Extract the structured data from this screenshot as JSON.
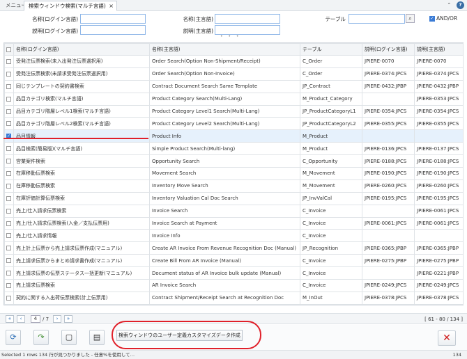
{
  "tabs": {
    "menu_label": "メニュー",
    "active_label": "検索ウィンドウ検索(マルチ言語)",
    "close_glyph": "×"
  },
  "top_icons": {
    "collapse": "⌃",
    "help": "?"
  },
  "filters": {
    "name_login": "名称(ログイン言語)",
    "desc_login": "説明(ログイン言語)",
    "name_main": "名称(主言語)",
    "desc_main": "説明(主言語)",
    "table": "テーブル",
    "andor": "AND/OR",
    "andor_checked": true
  },
  "grid": {
    "columns": [
      "名称(ログイン言語)",
      "名称(主言語)",
      "テーブル",
      "説明(ログイン言語)",
      "説明(主言語)"
    ],
    "rows": [
      {
        "name_login": "受発注伝票検索(未入出発注伝票選択用)",
        "name_main": "Order Search(Option Non-Shipment/Receipt)",
        "table": "C_Order",
        "desc_login": "JPIERE-0070",
        "desc_main": "JPIERE-0070",
        "checked": false
      },
      {
        "name_login": "受発注伝票検索(未請求受発注伝票選択用)",
        "name_main": "Order Search(Option Non-Invoice)",
        "table": "C_Order",
        "desc_login": "JPIERE-0374:JPCS",
        "desc_main": "JPIERE-0374:JPCS",
        "checked": false
      },
      {
        "name_login": "同じテンプレートの契約書検索",
        "name_main": "Contract Document Search Same Template",
        "table": "JP_Contract",
        "desc_login": "JPIERE-0432:JPBP",
        "desc_main": "JPIERE-0432:JPBP",
        "checked": false
      },
      {
        "name_login": "品目カテゴリ検索(マルチ言語)",
        "name_main": "Product Category Search(Multi-Lang)",
        "table": "M_Product_Category",
        "desc_login": "",
        "desc_main": "JPIERE-0353:JPCS",
        "checked": false
      },
      {
        "name_login": "品目カテゴリ階層レベル1検索(マルチ言語)",
        "name_main": "Product Category Level1 Search(Multi-Lang)",
        "table": "JP_ProductCategoryL1",
        "desc_login": "JPIERE-0354:JPCS",
        "desc_main": "JPIERE-0354:JPCS",
        "checked": false
      },
      {
        "name_login": "品目カテゴリ階層レベル2検索(マルチ言語)",
        "name_main": "Product Category Level2 Search(Multi-Lang)",
        "table": "JP_ProductCategoryL2",
        "desc_login": "JPIERE-0355:JPCS",
        "desc_main": "JPIERE-0355:JPCS",
        "checked": false
      },
      {
        "name_login": "品目情報",
        "name_main": "Product Info",
        "table": "M_Product",
        "desc_login": "",
        "desc_main": "",
        "checked": true
      },
      {
        "name_login": "品目検索(簡易版)(マルチ言語)",
        "name_main": "Simple Product Search(Multi-lang)",
        "table": "M_Product",
        "desc_login": "JPIERE-0136:JPCS",
        "desc_main": "JPIERE-0137:JPCS",
        "checked": false
      },
      {
        "name_login": "営業案件検索",
        "name_main": "Opportunity Search",
        "table": "C_Opportunity",
        "desc_login": "JPIERE-0188:JPCS",
        "desc_main": "JPIERE-0188:JPCS",
        "checked": false
      },
      {
        "name_login": "在庫移動伝票検索",
        "name_main": "Movement Search",
        "table": "M_Movement",
        "desc_login": "JPIERE-0190:JPCS",
        "desc_main": "JPIERE-0190:JPCS",
        "checked": false
      },
      {
        "name_login": "在庫移動伝票検索",
        "name_main": "Inventory Move Search",
        "table": "M_Movement",
        "desc_login": "JPIERE-0260:JPCS",
        "desc_main": "JPIERE-0260:JPCS",
        "checked": false
      },
      {
        "name_login": "在庫評価計算伝票検索",
        "name_main": "Inventory Valuation Cal Doc Search",
        "table": "JP_InvValCal",
        "desc_login": "JPIERE-0195:JPCS",
        "desc_main": "JPIERE-0195:JPCS",
        "checked": false
      },
      {
        "name_login": "売上/仕入請求伝票検索",
        "name_main": "Invoice Search",
        "table": "C_Invoice",
        "desc_login": "",
        "desc_main": "JPIERE-0061:JPCS",
        "checked": false
      },
      {
        "name_login": "売上/仕入請求伝票検索(入金／支払伝票用)",
        "name_main": "Invoice Search at Payment",
        "table": "C_Invoice",
        "desc_login": "JPIERE-0061:JPCS",
        "desc_main": "JPIERE-0061:JPCS",
        "checked": false
      },
      {
        "name_login": "売上/仕入請求情報",
        "name_main": "Invoice Info",
        "table": "C_Invoice",
        "desc_login": "",
        "desc_main": "",
        "checked": false
      },
      {
        "name_login": "売上計上伝票から売上請求伝票作成(マニュアル)",
        "name_main": "Create AR Invoice From Revenue Recognition Doc (Manual)",
        "table": "JP_Recognition",
        "desc_login": "JPIERE-0365:JPBP",
        "desc_main": "JPIERE-0365:JPBP",
        "checked": false
      },
      {
        "name_login": "売上請求伝票からまとめ請求書作成(マニュアル)",
        "name_main": "Create Bill From AR Invoice (Manual)",
        "table": "C_Invoice",
        "desc_login": "JPIERE-0275:JPBP",
        "desc_main": "JPIERE-0275:JPBP",
        "checked": false
      },
      {
        "name_login": "売上請求伝票の伝票ステータス一括更新(マニュアル)",
        "name_main": "Document status of AR Invoice bulk update (Manual)",
        "table": "C_Invoice",
        "desc_login": "",
        "desc_main": "JPIERE-0221:JPBP",
        "checked": false
      },
      {
        "name_login": "売上請求伝票検索",
        "name_main": "AR Invoice Search",
        "table": "C_Invoice",
        "desc_login": "JPIERE-0249:JPCS",
        "desc_main": "JPIERE-0249:JPCS",
        "checked": false
      },
      {
        "name_login": "契約に関する入出荷伝票検索(計上伝票用)",
        "name_main": "Contract Shipment/Receipt Search at Recognition Doc",
        "table": "M_InOut",
        "desc_login": "JPIERE-0378:JPCS",
        "desc_main": "JPIERE-0378:JPCS",
        "checked": false
      }
    ]
  },
  "pager": {
    "first": "«",
    "prev": "‹",
    "next": "›",
    "last": "»",
    "page": "4",
    "total": "/ 7",
    "range": "[ 61 - 80 / 134 ]"
  },
  "toolbar": {
    "refresh_icon": "⟳",
    "ok_icon": "↷",
    "zoom_icon": "▢",
    "export_icon": "▤",
    "customize_label": "検索ウィンドウのユーザー定義カスタマイズデータ作成",
    "cancel_icon": "✕"
  },
  "status": {
    "left": "Selected 1 rows 134 行が見つかりました - 任意%を使用して…",
    "right": "134"
  }
}
